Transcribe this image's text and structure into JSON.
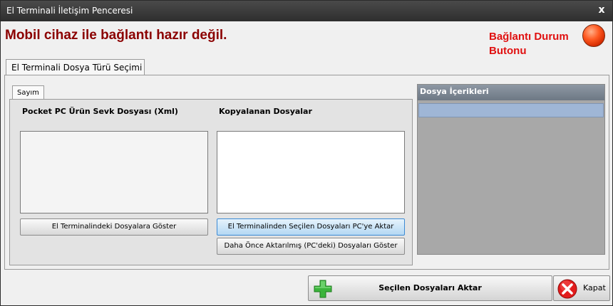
{
  "window": {
    "title": "El Terminali İletişim Penceresi",
    "close_glyph": "x"
  },
  "status": {
    "message": "Mobil cihaz ile bağlantı hazır değil.",
    "connection_label_line1": "Bağlantı Durum",
    "connection_label_line2": "Butonu",
    "indicator_color": "#ff4a1a"
  },
  "outer_tabs": [
    {
      "label": "El Terminali Dosya Türü Seçimi",
      "active": true
    }
  ],
  "inner_tabs": [
    {
      "label": "Sayım",
      "active": true
    }
  ],
  "left_column": {
    "header": "Pocket PC Ürün Sevk Dosyası (Xml)",
    "items": [],
    "button_label": "El Terminalindeki Dosyalara Göster"
  },
  "right_column": {
    "header": "Kopyalanan Dosyalar",
    "items": [],
    "transfer_button_label": "El Terminalinden Seçilen Dosyaları PC'ye Aktar",
    "history_button_label": "Daha Önce Aktarılmış (PC'deki) Dosyaları Göster"
  },
  "contents_panel": {
    "header": "Dosya İçerikleri",
    "rows": []
  },
  "footer": {
    "transfer_label": "Seçilen Dosyaları Aktar",
    "close_label": "Kapat"
  },
  "icons": {
    "plus": "plus-icon",
    "close": "x-icon",
    "status_indicator": "status-indicator-icon"
  },
  "colors": {
    "status_text": "#8b0000",
    "connection_label": "#e01010",
    "plus_icon": "#3cb43c",
    "close_icon": "#e21c1c",
    "contents_header": "#7a8490",
    "contents_selected_row": "#9fb6d6"
  }
}
